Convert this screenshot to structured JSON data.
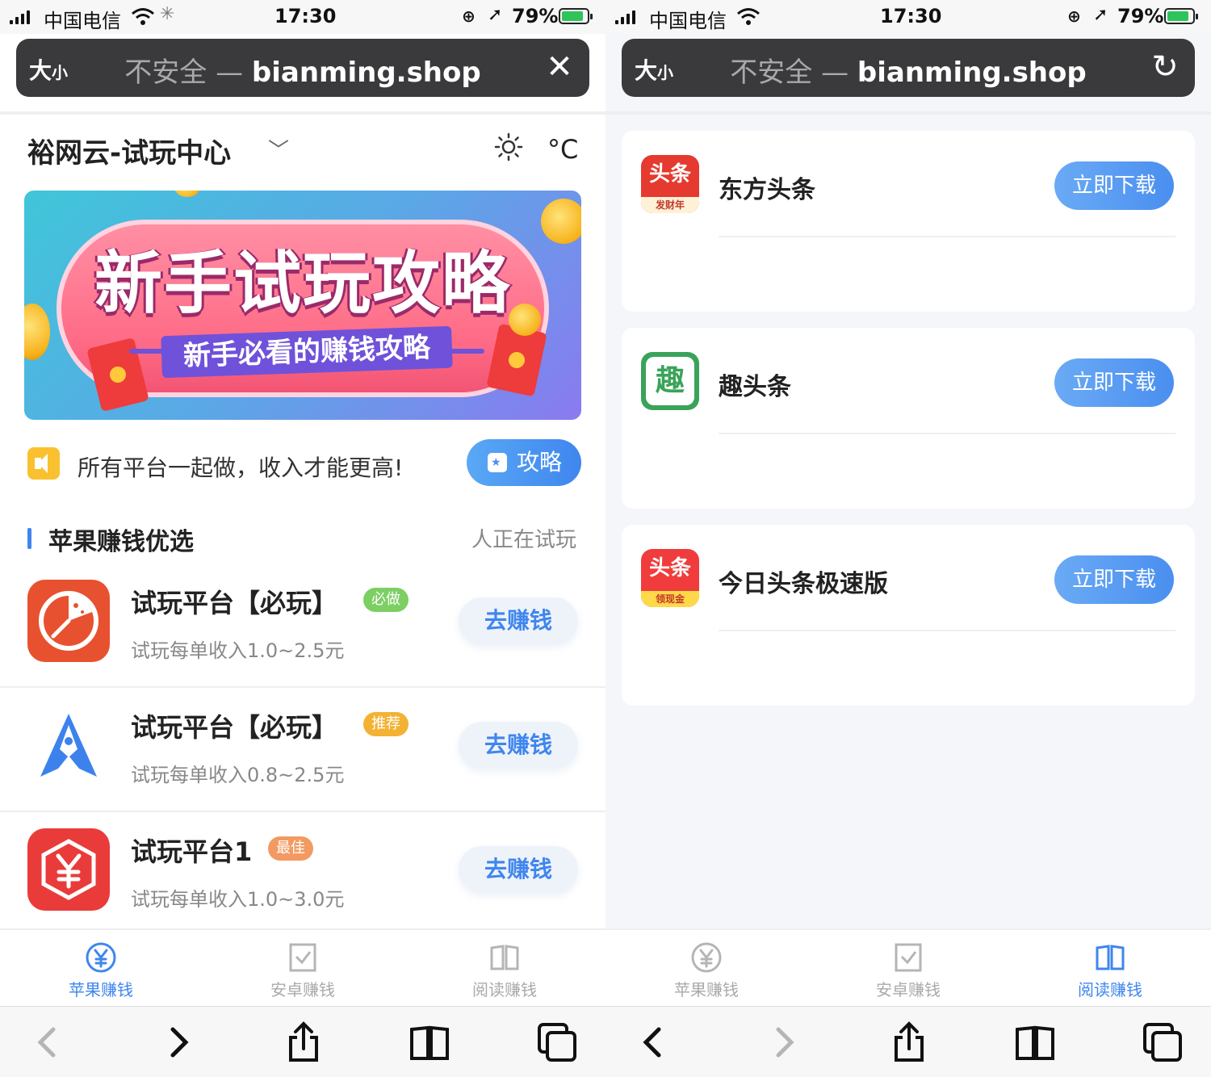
{
  "status_bar": {
    "carrier": "中国电信",
    "time": "17:30",
    "battery": "79%"
  },
  "browser": {
    "text_size": "大",
    "text_size_small": "小",
    "not_secure": "不安全",
    "separator": "—",
    "domain": "bianming.shop",
    "left_action": "✕",
    "right_action": "↻"
  },
  "left_page": {
    "title": "裕网云-试玩中心",
    "temp_unit": "°C",
    "banner": {
      "title": "新手试玩攻略",
      "subtitle": "新手必看的赚钱攻略"
    },
    "notice": {
      "text": "所有平台一起做，收入才能更高!",
      "guide_button": "攻略"
    },
    "section": {
      "title": "苹果赚钱优选",
      "meta": "人正在试玩"
    },
    "apps": [
      {
        "name": "试玩平台【必玩】",
        "badge": "必做",
        "badge_color": "#7ccf62",
        "desc": "试玩每单收入1.0~2.5元",
        "button": "去赚钱",
        "icon": "pie-clock-icon"
      },
      {
        "name": "试玩平台【必玩】",
        "badge": "推荐",
        "badge_color": "#f3b233",
        "desc": "试玩每单收入0.8~2.5元",
        "button": "去赚钱",
        "icon": "rocket-a-icon"
      },
      {
        "name": "试玩平台1",
        "badge": "最佳",
        "badge_color": "#f29a62",
        "desc": "试玩每单收入1.0~3.0元",
        "button": "去赚钱",
        "icon": "yuan-hexagon-icon"
      }
    ]
  },
  "right_page": {
    "apps": [
      {
        "name": "东方头条",
        "button": "立即下载",
        "icon_text": "头条",
        "icon_sub": "发财年",
        "icon": "dongfang-toutiao-icon"
      },
      {
        "name": "趣头条",
        "button": "立即下载",
        "icon_text": "趣",
        "icon": "qutoutiao-icon"
      },
      {
        "name": "今日头条极速版",
        "button": "立即下载",
        "icon_text": "头条",
        "icon_sub": "领现金",
        "icon": "toutiao-lite-icon"
      }
    ]
  },
  "tabs": [
    {
      "label": "苹果赚钱",
      "icon": "yuan-circle-icon"
    },
    {
      "label": "安卓赚钱",
      "icon": "checkbox-icon"
    },
    {
      "label": "阅读赚钱",
      "icon": "book-icon"
    }
  ],
  "colors": {
    "accent": "#3f86ee",
    "url_bar": "#3a3a3c",
    "banner_pink": "#ff6b86"
  }
}
